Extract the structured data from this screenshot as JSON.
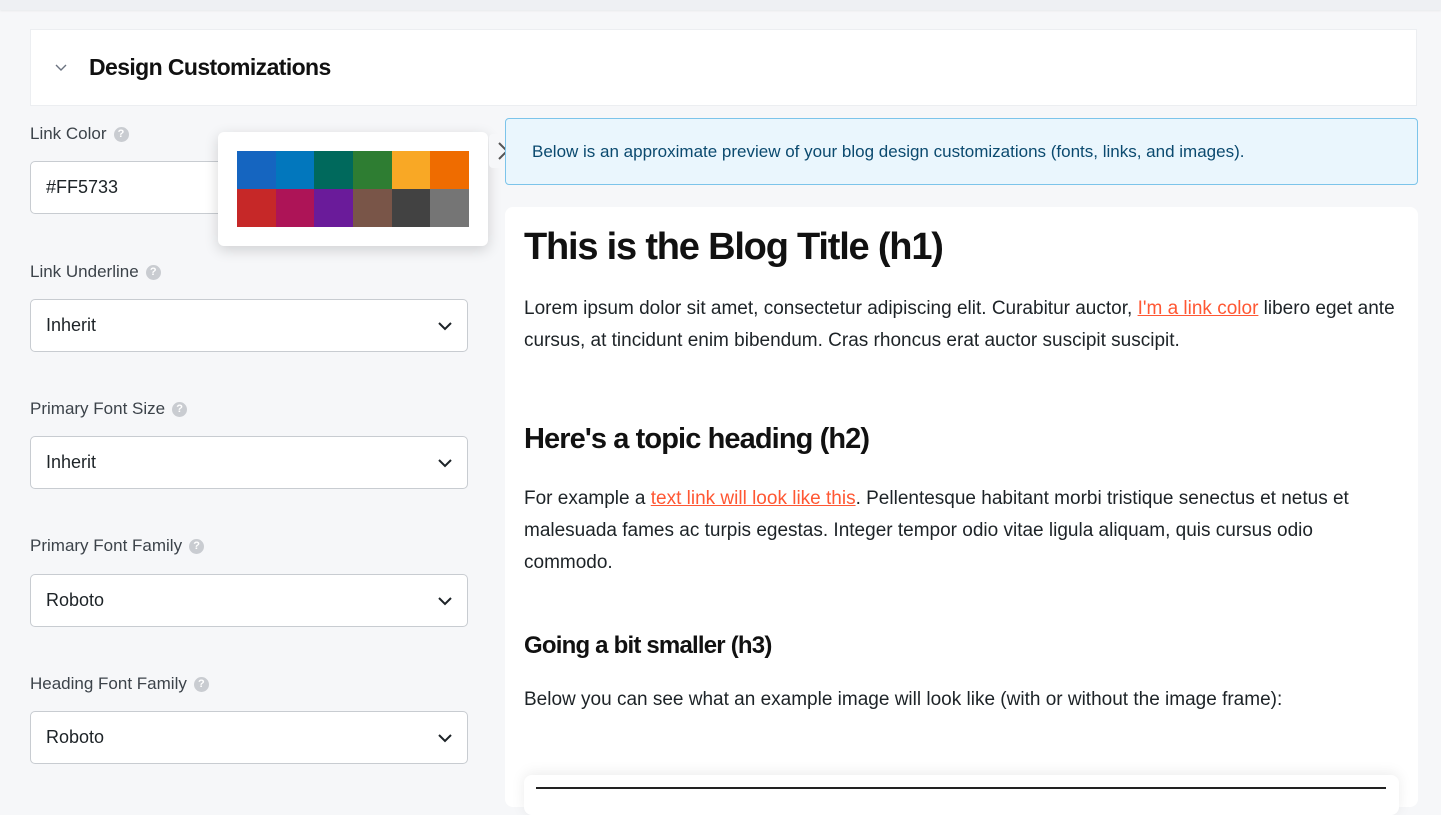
{
  "section": {
    "title": "Design Customizations"
  },
  "fields": {
    "link_color": {
      "label": "Link Color",
      "value": "#FF5733"
    },
    "link_underline": {
      "label": "Link Underline",
      "value": "Inherit"
    },
    "primary_font_size": {
      "label": "Primary Font Size",
      "value": "Inherit"
    },
    "primary_font_family": {
      "label": "Primary Font Family",
      "value": "Roboto"
    },
    "heading_font_family": {
      "label": "Heading Font Family",
      "value": "Roboto"
    }
  },
  "help_glyph": "?",
  "swatches": [
    "#1565C0",
    "#0277BD",
    "#00695C",
    "#2E7D32",
    "#F9A825",
    "#EF6C00",
    "#C62828",
    "#AD1457",
    "#6A1B9A",
    "#795548",
    "#424242",
    "#757575"
  ],
  "notice": {
    "text": "Below is an approximate preview of your blog design customizations (fonts, links, and images)."
  },
  "preview": {
    "h1": "This is the Blog Title (h1)",
    "p1_before": "Lorem ipsum dolor sit amet, consectetur adipiscing elit. Curabitur auctor, ",
    "p1_link": "I'm a link color",
    "p1_after": " libero eget ante cursus, at tincidunt enim bibendum. Cras rhoncus erat auctor suscipit suscipit.",
    "h2": "Here's a topic heading (h2)",
    "p2_before": "For example a ",
    "p2_link": "text link will look like this",
    "p2_after": ". Pellentesque habitant morbi tristique senectus et netus et malesuada fames ac turpis egestas. Integer tempor odio vitae ligula aliquam, quis cursus odio commodo.",
    "h3": "Going a bit smaller (h3)",
    "p3": "Below you can see what an example image will look like (with or without the image frame):"
  },
  "colors": {
    "link": "#FF5733",
    "notice_bg": "#eaf6fd",
    "notice_border": "#7cc4ea"
  },
  "icons": {
    "collapse": "chevron-down-icon",
    "help": "help-icon",
    "close": "close-icon",
    "caret": "chevron-down-icon"
  }
}
